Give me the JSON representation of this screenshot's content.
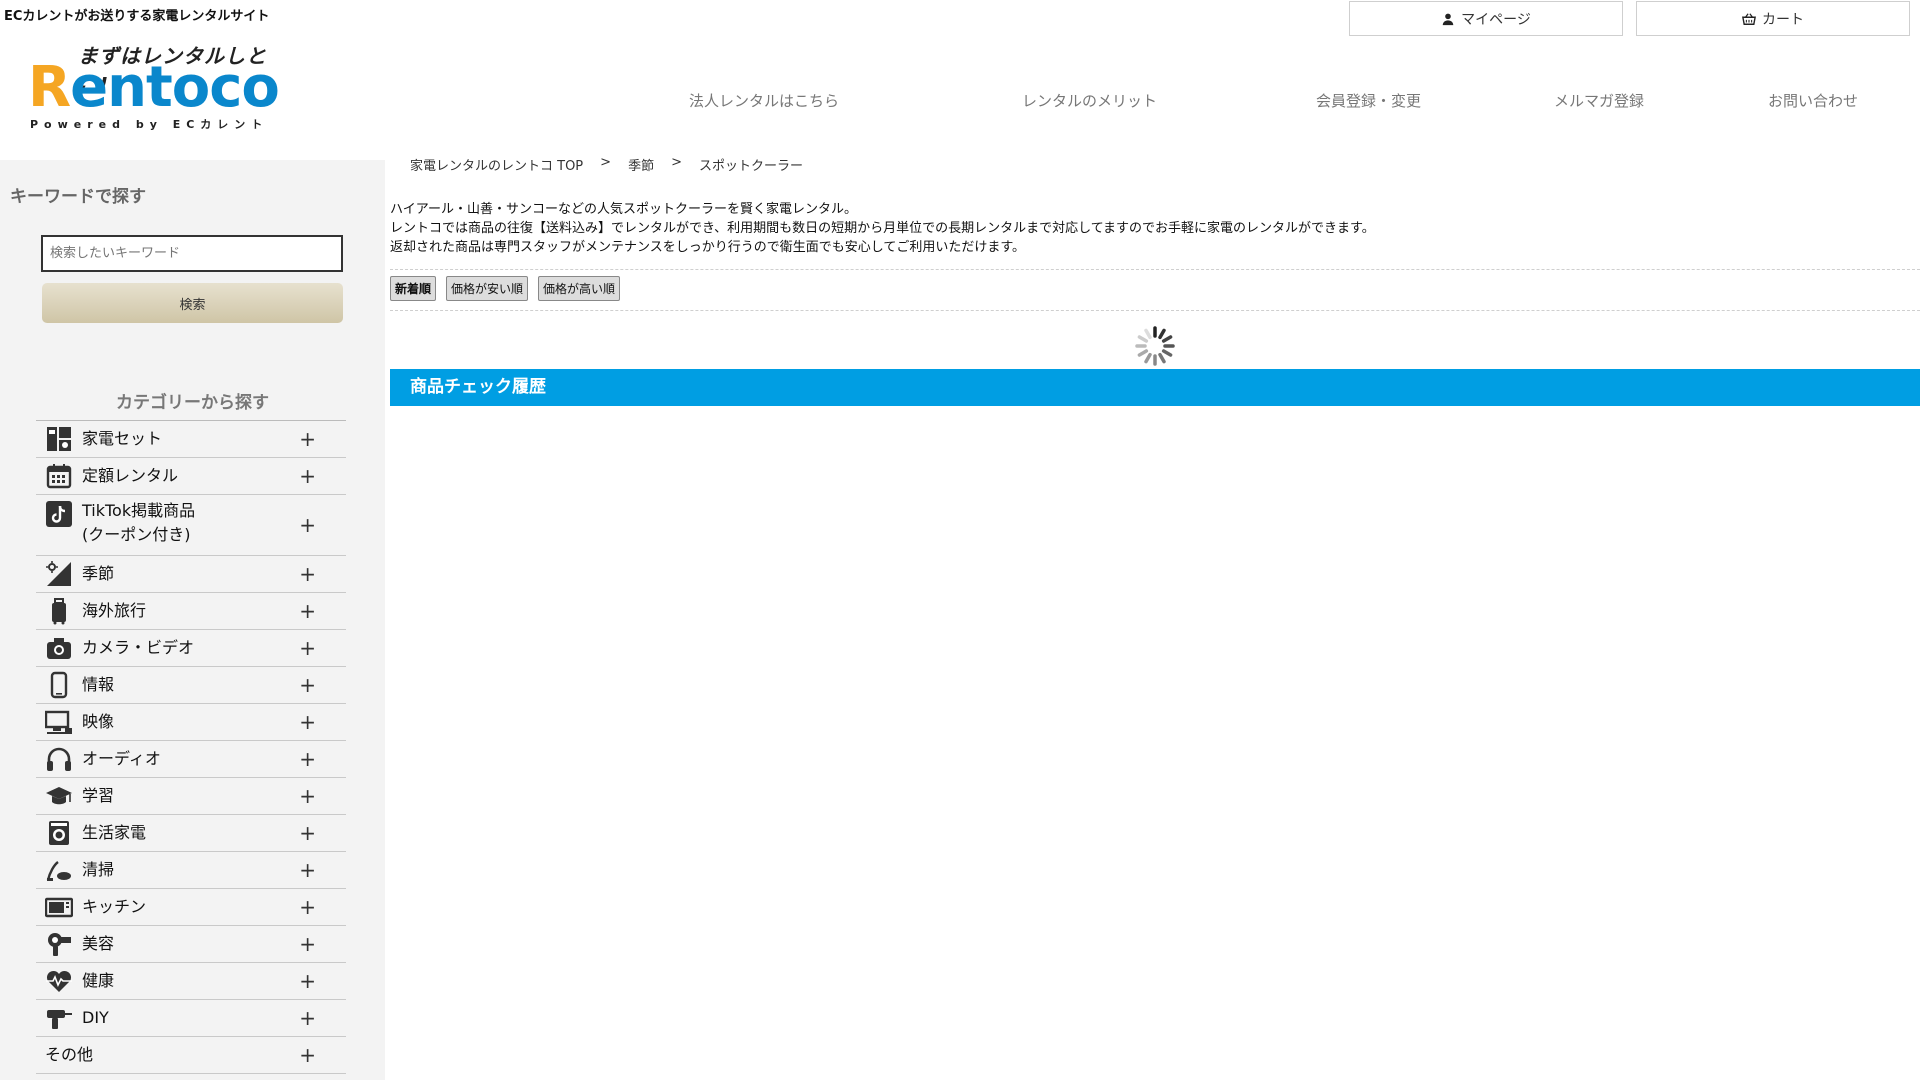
{
  "header": {
    "tagline": "ECカレントがお送りする家電レンタルサイト",
    "logo": {
      "catch": "まずはレンタルしとこ!",
      "brand_first": "R",
      "brand_rest": "entoco",
      "powered": "Powered by ECカレント"
    },
    "mypage_label": "マイページ",
    "cart_label": "カート",
    "nav": [
      "法人レンタルはこちら",
      "レンタルのメリット",
      "会員登録・変更",
      "メルマガ登録",
      "お問い合わせ"
    ]
  },
  "sidebar": {
    "keyword_title": "キーワードで探す",
    "search_placeholder": "検索したいキーワード",
    "search_button": "検索",
    "category_title": "カテゴリーから探す",
    "categories": [
      {
        "label": "家電セット",
        "icon": "appliance-set-icon"
      },
      {
        "label": "定額レンタル",
        "icon": "calendar-icon"
      },
      {
        "label": "TikTok掲載商品\n(クーポン付き)",
        "icon": "tiktok-icon"
      },
      {
        "label": "季節",
        "icon": "season-icon"
      },
      {
        "label": "海外旅行",
        "icon": "suitcase-icon"
      },
      {
        "label": "カメラ・ビデオ",
        "icon": "camera-icon"
      },
      {
        "label": "情報",
        "icon": "smartphone-icon"
      },
      {
        "label": "映像",
        "icon": "tv-icon"
      },
      {
        "label": "オーディオ",
        "icon": "headphones-icon"
      },
      {
        "label": "学習",
        "icon": "graduation-cap-icon"
      },
      {
        "label": "生活家電",
        "icon": "washing-machine-icon"
      },
      {
        "label": "清掃",
        "icon": "vacuum-icon"
      },
      {
        "label": "キッチン",
        "icon": "microwave-icon"
      },
      {
        "label": "美容",
        "icon": "hair-dryer-icon"
      },
      {
        "label": "健康",
        "icon": "heartbeat-icon"
      },
      {
        "label": "DIY",
        "icon": "drill-icon"
      },
      {
        "label": "その他",
        "icon": ""
      }
    ],
    "expand_symbol": "+"
  },
  "main": {
    "breadcrumb": [
      "家電レンタルのレントコ TOP",
      "季節",
      "スポットクーラー"
    ],
    "breadcrumb_sep": ">",
    "description": [
      "ハイアール・山善・サンコーなどの人気スポットクーラーを賢く家電レンタル。",
      "レントコでは商品の往復【送料込み】でレンタルができ、利用期間も数日の短期から月単位での長期レンタルまで対応してますのでお手軽に家電のレンタルができます。",
      "返却された商品は専門スタッフがメンテナンスをしっかり行うので衛生面でも安心してご利用いただけます。"
    ],
    "sort_buttons": [
      "新着順",
      "価格が安い順",
      "価格が高い順"
    ],
    "history_title": "商品チェック履歴"
  },
  "colors": {
    "accent": "#009ee3",
    "brand_blue": "#0a87cc",
    "brand_orange": "#f5a623"
  }
}
